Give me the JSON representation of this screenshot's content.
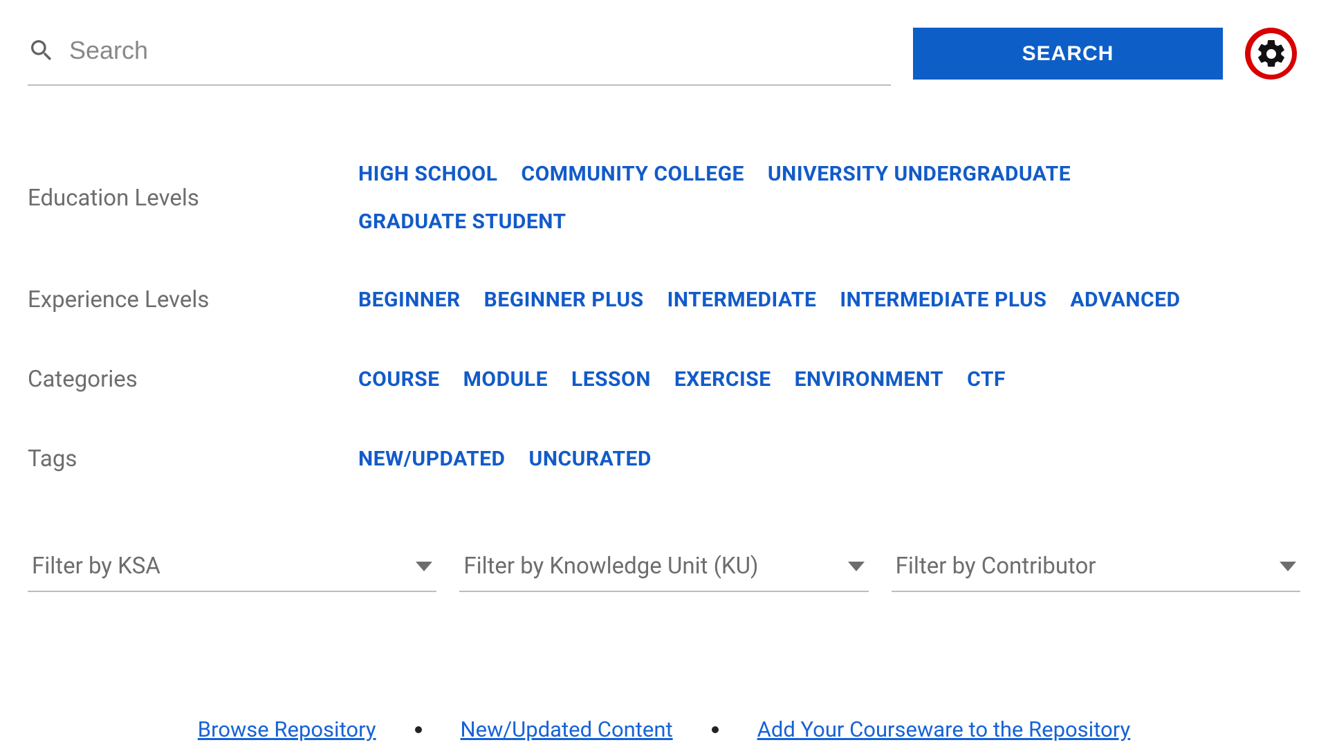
{
  "search": {
    "placeholder": "Search",
    "button_label": "SEARCH"
  },
  "filters": {
    "education": {
      "label": "Education Levels",
      "items": [
        "HIGH SCHOOL",
        "COMMUNITY COLLEGE",
        "UNIVERSITY UNDERGRADUATE",
        "GRADUATE STUDENT"
      ]
    },
    "experience": {
      "label": "Experience Levels",
      "items": [
        "BEGINNER",
        "BEGINNER PLUS",
        "INTERMEDIATE",
        "INTERMEDIATE PLUS",
        "ADVANCED"
      ]
    },
    "categories": {
      "label": "Categories",
      "items": [
        "COURSE",
        "MODULE",
        "LESSON",
        "EXERCISE",
        "ENVIRONMENT",
        "CTF"
      ]
    },
    "tags": {
      "label": "Tags",
      "items": [
        "NEW/UPDATED",
        "UNCURATED"
      ]
    }
  },
  "selects": {
    "ksa": "Filter by KSA",
    "ku": "Filter by Knowledge Unit (KU)",
    "contributor": "Filter by Contributor"
  },
  "links": {
    "browse": "Browse Repository",
    "new": "New/Updated Content",
    "add": "Add Your Courseware to the Repository"
  }
}
